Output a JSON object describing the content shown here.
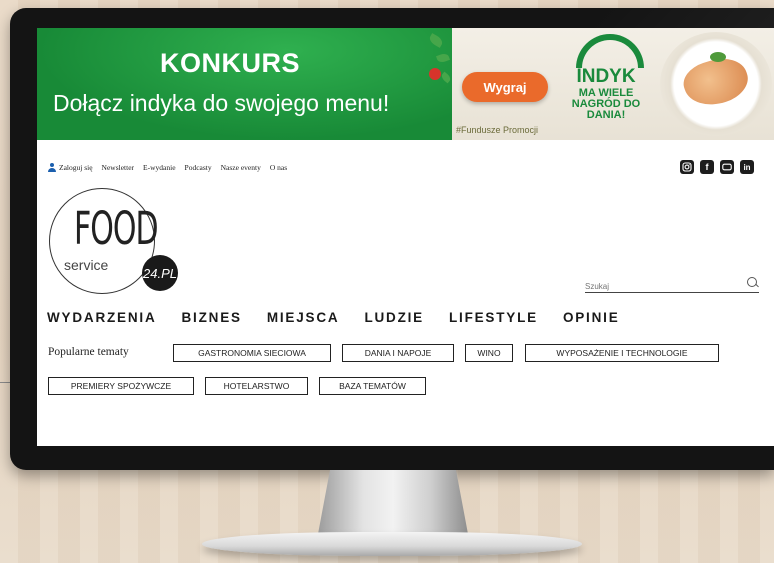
{
  "ad": {
    "title": "KONKURS",
    "subtitle": "Dołącz indyka do swojego menu!",
    "button": "Wygraj",
    "hashtag": "#Fundusze Promocji",
    "brand_big": "INDYK",
    "brand_small": "MA WIELE NAGRÓD DO DANIA!",
    "colors": {
      "green": "#1a8a3c",
      "orange": "#ea6a2b"
    }
  },
  "topnav": {
    "login": "Zaloguj się",
    "items": [
      "Newsletter",
      "E-wydanie",
      "Podcasty",
      "Nasze eventy",
      "O nas"
    ]
  },
  "social": [
    "instagram-icon",
    "facebook-icon",
    "youtube-icon",
    "linkedin-icon"
  ],
  "logo": {
    "food": "FOOD",
    "service": "service",
    "badge": "24.PL"
  },
  "search": {
    "placeholder": "Szukaj"
  },
  "mainnav": [
    "WYDARZENIA",
    "BIZNES",
    "MIEJSCA",
    "LUDZIE",
    "LIFESTYLE",
    "OPINIE"
  ],
  "topics": {
    "label": "Popularne tematy",
    "chips": [
      "GASTRONOMIA SIECIOWA",
      "DANIA I NAPOJE",
      "WINO",
      "WYPOSAŻENIE I TECHNOLOGIE",
      "PREMIERY SPOŻYWCZE",
      "HOTELARSTWO",
      "BAZA TEMATÓW"
    ]
  }
}
